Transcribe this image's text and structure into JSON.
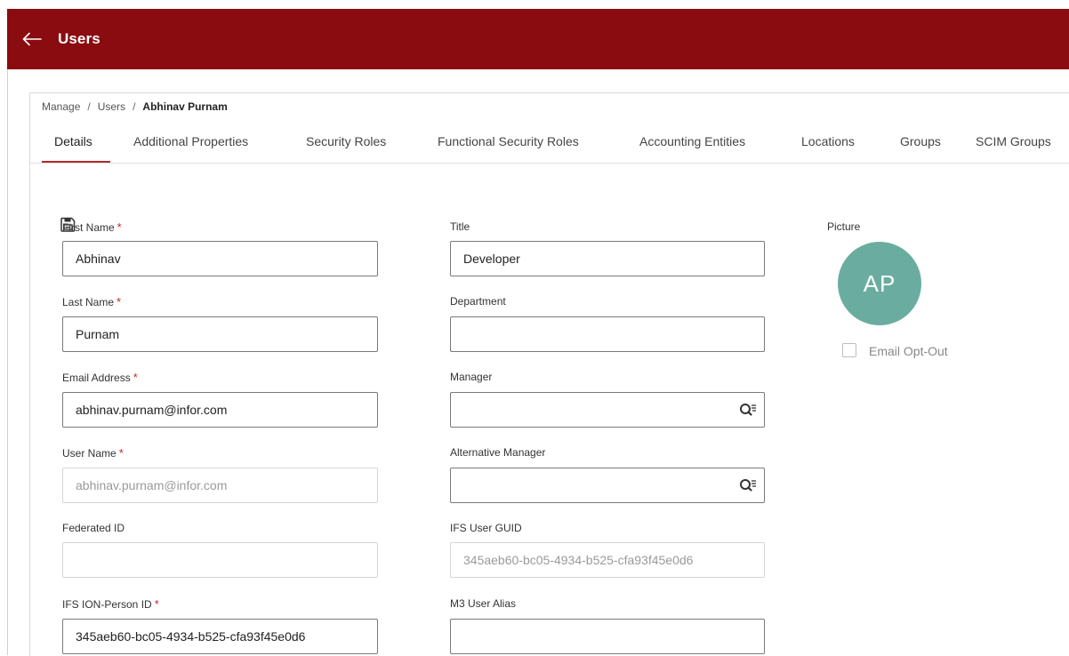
{
  "header": {
    "title": "Users"
  },
  "breadcrumb": {
    "items": [
      "Manage",
      "Users"
    ],
    "current": "Abhinav Purnam",
    "separator": "/"
  },
  "tabs": [
    {
      "label": "Details",
      "active": true
    },
    {
      "label": "Additional Properties"
    },
    {
      "label": "Security Roles"
    },
    {
      "label": "Functional Security Roles"
    },
    {
      "label": "Accounting Entities"
    },
    {
      "label": "Locations"
    },
    {
      "label": "Groups"
    },
    {
      "label": "SCIM Groups"
    }
  ],
  "form": {
    "first_name": {
      "label": "First Name",
      "value": "Abhinav",
      "required": "*"
    },
    "last_name": {
      "label": "Last Name",
      "value": "Purnam",
      "required": "*"
    },
    "email": {
      "label": "Email Address",
      "value": "abhinav.purnam@infor.com",
      "required": "*"
    },
    "user_name": {
      "label": "User Name",
      "value": "abhinav.purnam@infor.com",
      "required": "*"
    },
    "federated_id": {
      "label": "Federated ID",
      "value": ""
    },
    "ion_person_id": {
      "label": "IFS ION-Person ID",
      "value": "345aeb60-bc05-4934-b525-cfa93f45e0d6",
      "required": "*"
    },
    "title": {
      "label": "Title",
      "value": "Developer"
    },
    "department": {
      "label": "Department",
      "value": ""
    },
    "manager": {
      "label": "Manager",
      "value": ""
    },
    "alt_manager": {
      "label": "Alternative Manager",
      "value": ""
    },
    "ifs_user_guid": {
      "label": "IFS User GUID",
      "value": "345aeb60-bc05-4934-b525-cfa93f45e0d6"
    },
    "m3_user_alias": {
      "label": "M3 User Alias",
      "value": ""
    }
  },
  "picture": {
    "label": "Picture",
    "initials": "AP"
  },
  "email_opt_out": {
    "label": "Email Opt-Out",
    "checked": false
  },
  "icons": {
    "back": "arrow-left-icon",
    "save": "save-icon",
    "lookup": "search-lookup-icon"
  },
  "colors": {
    "header_bg": "#8a0c10",
    "accent": "#b8272b",
    "avatar_bg": "#6aada0",
    "required": "#c62828"
  }
}
